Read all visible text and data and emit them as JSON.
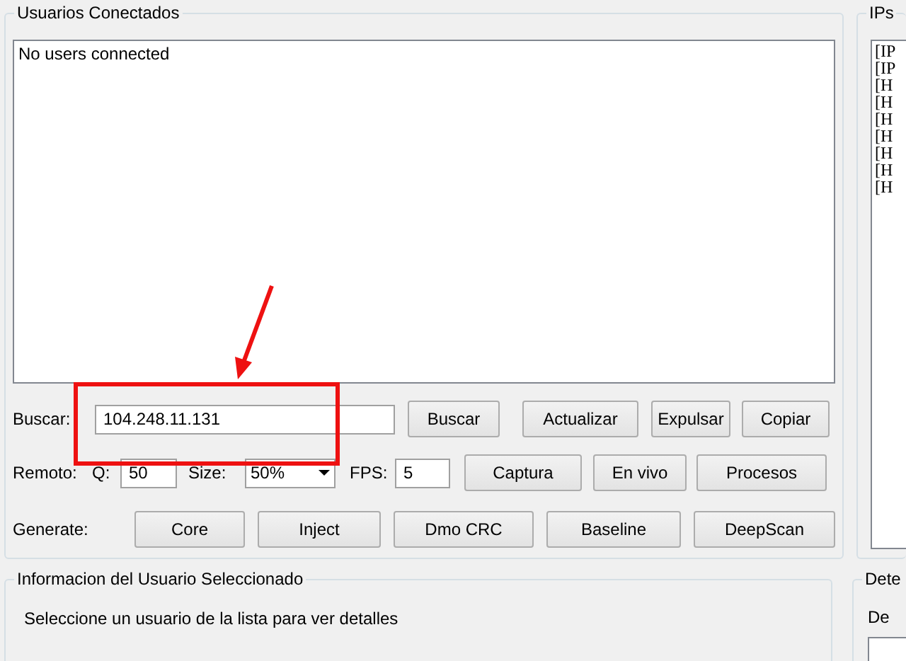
{
  "users_panel": {
    "title": "Usuarios Conectados",
    "list_items": [
      "No users connected"
    ],
    "search": {
      "label": "Buscar:",
      "value": "104.248.11.131",
      "buttons": [
        "Buscar",
        "Actualizar",
        "Expulsar",
        "Copiar"
      ]
    },
    "remote": {
      "label": "Remoto:",
      "quality_label": "Q:",
      "quality_value": "50",
      "size_label": "Size:",
      "size_value": "50%",
      "fps_label": "FPS:",
      "fps_value": "5",
      "buttons": [
        "Captura",
        "En vivo",
        "Procesos"
      ]
    },
    "generate": {
      "label": "Generate:",
      "buttons": [
        "Core",
        "Inject",
        "Dmo CRC",
        "Baseline",
        "DeepScan"
      ]
    }
  },
  "ips_panel": {
    "title": "IPs",
    "list_items": [
      "[IP",
      "[IP",
      "[H",
      "[H",
      "[H",
      "[H",
      "[H",
      "[H",
      "[H"
    ]
  },
  "info_panel": {
    "title": "Informacion del Usuario Seleccionado",
    "message": "Seleccione un usuario de la lista para ver detalles"
  },
  "details_panel": {
    "title": "Dete",
    "label": "De"
  }
}
